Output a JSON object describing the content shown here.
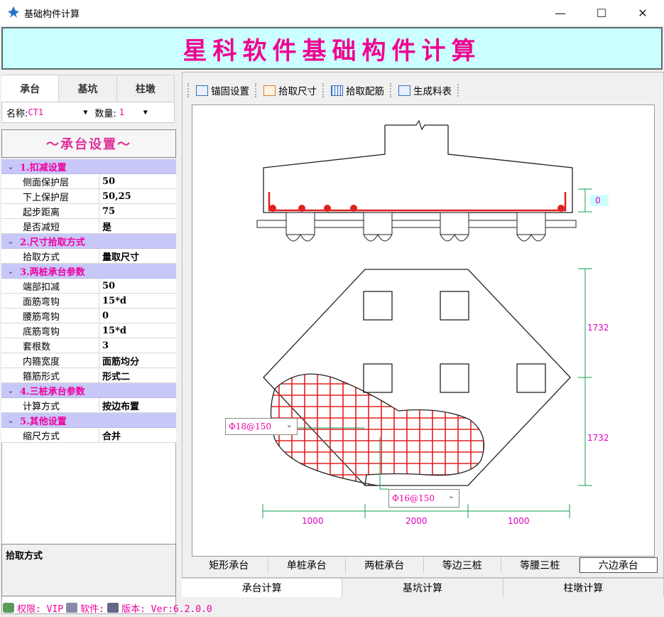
{
  "window": {
    "title": "基础构件计算",
    "minimize": "—",
    "maximize": "☐",
    "close": "✕"
  },
  "banner": {
    "title": "星科软件基础构件计算"
  },
  "left": {
    "tabs": [
      "承台",
      "基坑",
      "柱墩"
    ],
    "name_label": "名称:",
    "name_value": "CT1",
    "qty_label": "数量:",
    "qty_value": "1",
    "section_header": "～承台设置～",
    "categories": [
      {
        "title": "1.扣减设置",
        "rows": [
          [
            "侧面保护层",
            "50"
          ],
          [
            "下上保护层",
            "50,25"
          ],
          [
            "起步距离",
            "75"
          ],
          [
            "是否减短",
            "是"
          ]
        ]
      },
      {
        "title": "2.尺寸拾取方式",
        "rows": [
          [
            "拾取方式",
            "量取尺寸"
          ]
        ]
      },
      {
        "title": "3.两桩承台参数",
        "rows": [
          [
            "端部扣减",
            "50"
          ],
          [
            "面筋弯钩",
            "15*d"
          ],
          [
            "腰筋弯钩",
            "0"
          ],
          [
            "底筋弯钩",
            "15*d"
          ],
          [
            "套根数",
            "3"
          ],
          [
            "内箍宽度",
            "面筋均分"
          ],
          [
            "箍筋形式",
            "形式二"
          ]
        ]
      },
      {
        "title": "4.三桩承台参数",
        "rows": [
          [
            "计算方式",
            "按边布置"
          ]
        ]
      },
      {
        "title": "5.其他设置",
        "rows": [
          [
            "缩尺方式",
            "合并"
          ]
        ]
      }
    ],
    "description_title": "拾取方式"
  },
  "toolbar": {
    "buttons": [
      "锚固设置",
      "拾取尺寸",
      "拾取配筋",
      "生成料表"
    ]
  },
  "drawing": {
    "cover_dim": "0",
    "dim_right_upper": "1732",
    "dim_right_lower": "1732",
    "dim_bottom": [
      "1000",
      "2000",
      "1000"
    ],
    "rebar_top": "Φ18@150",
    "rebar_bottom": "Φ16@150",
    "colors": {
      "rebar": "#e02020",
      "dimension": "#10a050",
      "dimtext": "#e000c0"
    }
  },
  "subtabs": [
    "矩形承台",
    "单桩承台",
    "两桩承台",
    "等边三桩",
    "等腰三桩",
    "六边承台"
  ],
  "maintabs": [
    "承台计算",
    "基坑计算",
    "柱墩计算"
  ],
  "status": {
    "permission": "权限: VIP",
    "software": "软件:",
    "version": "版本: Ver:6.2.0.0"
  }
}
